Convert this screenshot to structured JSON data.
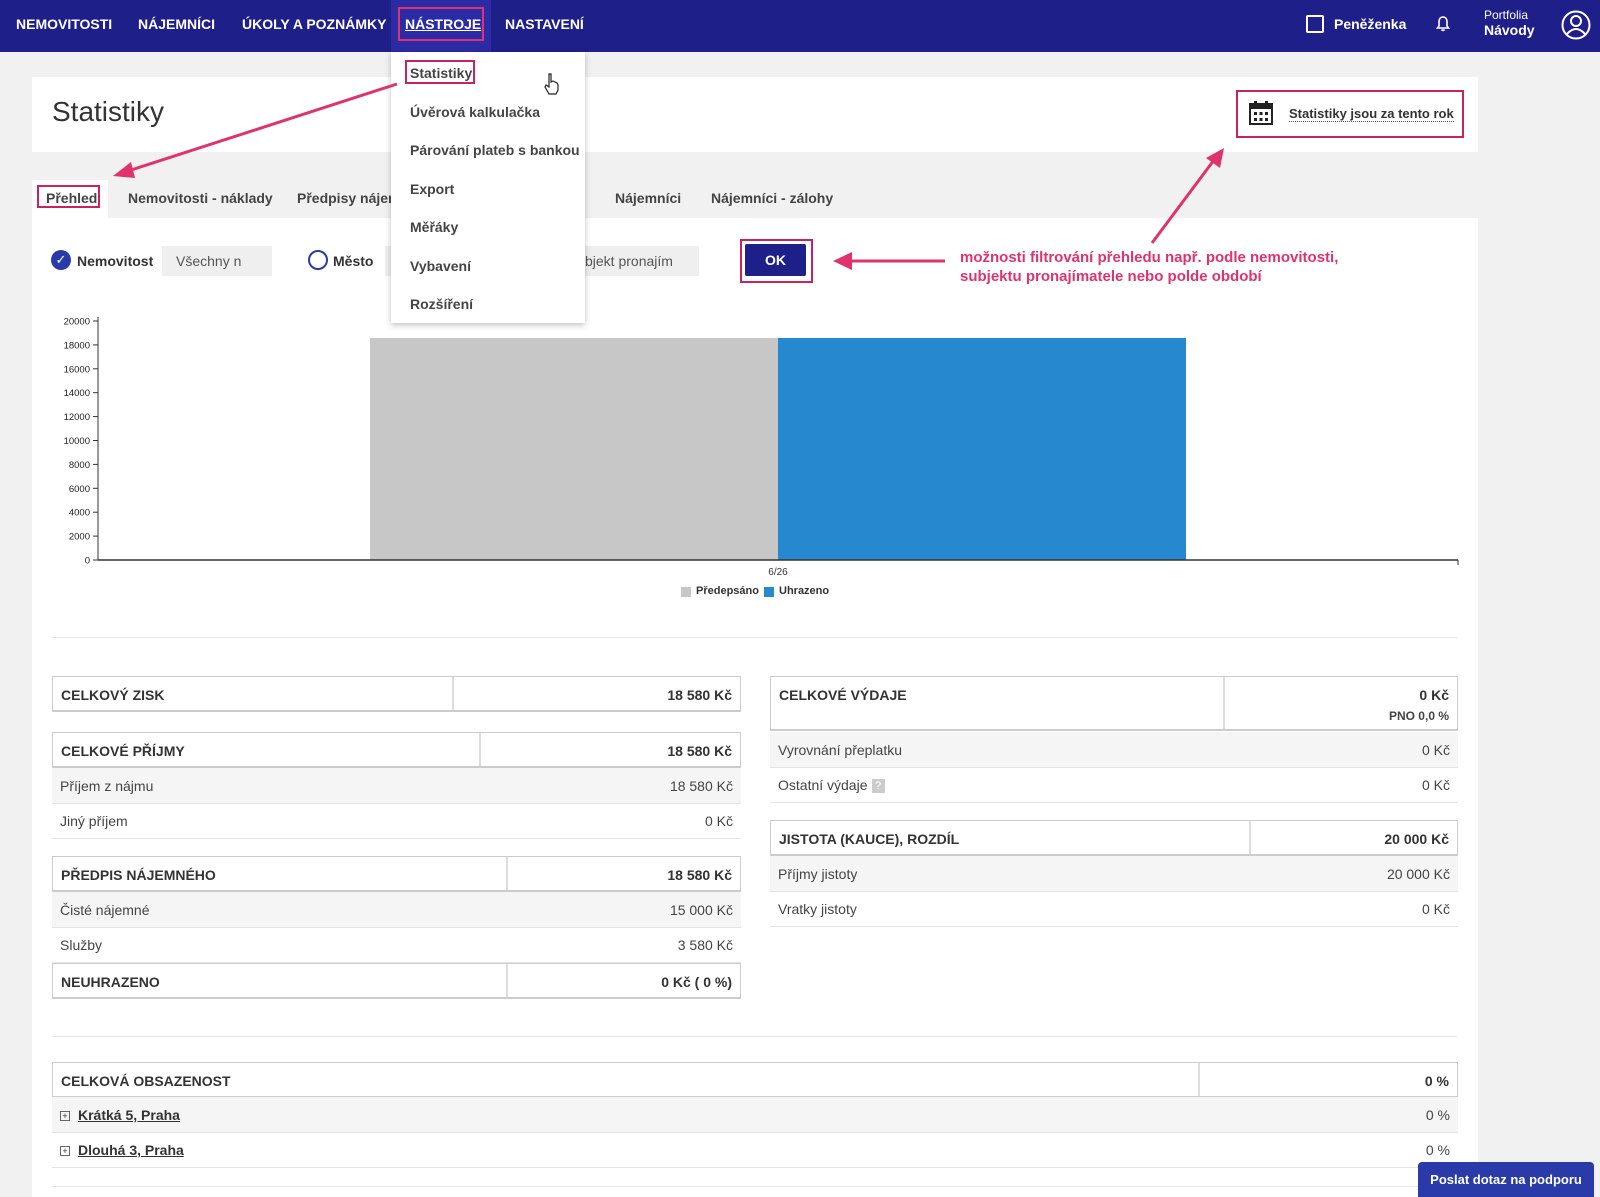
{
  "nav": {
    "items": [
      "NEMOVITOSTI",
      "NÁJEMNÍCI",
      "ÚKOLY A POZNÁMKY",
      "NÁSTROJE",
      "NASTAVENÍ"
    ],
    "wallet": "Peněženka",
    "portfolio_label": "Portfolia",
    "portfolio_name": "Návody"
  },
  "dropdown": {
    "items": [
      "Statistiky",
      "Úvěrová kalkulačka",
      "Párování plateb s bankou",
      "Export",
      "Měřáky",
      "Vybavení",
      "Rozšíření"
    ]
  },
  "header": {
    "title": "Statistiky",
    "period": "Statistiky jsou za tento rok"
  },
  "tabs": [
    "Přehled",
    "Nemovitosti - náklady",
    "Předpisy nájem",
    "Nájemníci",
    "Nájemníci - zálohy"
  ],
  "filters": {
    "property_label": "Nemovitost",
    "property_value": "Všechny n",
    "city_label": "Město",
    "subject_value": "bjekt pronajím",
    "ok": "OK"
  },
  "annotation": {
    "line1": "možnosti filtrování přehledu např. podle nemovitosti,",
    "line2": "subjektu pronajímatele nebo polde období"
  },
  "chart_data": {
    "type": "bar",
    "categories": [
      "6/26"
    ],
    "series": [
      {
        "name": "Předepsáno",
        "values": [
          18580
        ],
        "color": "#c7c7c7"
      },
      {
        "name": "Uhrazeno",
        "values": [
          18580
        ],
        "color": "#2688cf"
      }
    ],
    "yticks": [
      "20000",
      "18000",
      "16000",
      "14000",
      "12000",
      "10000",
      "8000",
      "6000",
      "4000",
      "2000",
      "0"
    ],
    "ylim": [
      0,
      20000
    ],
    "legend": "bottom"
  },
  "stats_left": {
    "total_profit_label": "CELKOVÝ ZISK",
    "total_profit_value": "18 580 Kč",
    "income_label": "CELKOVÉ PŘÍJMY",
    "income_value": "18 580 Kč",
    "rent_income_label": "Příjem z nájmu",
    "rent_income_value": "18 580 Kč",
    "other_income_label": "Jiný příjem",
    "other_income_value": "0 Kč",
    "rent_prescription_label": "PŘEDPIS NÁJEMNÉHO",
    "rent_prescription_value": "18 580 Kč",
    "net_rent_label": "Čisté nájemné",
    "net_rent_value": "15 000 Kč",
    "services_label": "Služby",
    "services_value": "3 580 Kč",
    "unpaid_label": "NEUHRAZENO",
    "unpaid_value": "0 Kč ( 0 %)"
  },
  "stats_right": {
    "expenses_label": "CELKOVÉ VÝDAJE",
    "expenses_value": "0 Kč",
    "pno": "PNO 0,0 %",
    "overpay_label": "Vyrovnání přeplatku",
    "overpay_value": "0 Kč",
    "other_expenses_label": "Ostatní výdaje",
    "other_expenses_value": "0 Kč",
    "qmark": "?",
    "deposit_label": "JISTOTA (KAUCE), ROZDÍL",
    "deposit_value": "20 000 Kč",
    "deposit_income_label": "Příjmy jistoty",
    "deposit_income_value": "20 000 Kč",
    "deposit_return_label": "Vratky jistoty",
    "deposit_return_value": "0 Kč"
  },
  "occupancy": {
    "label": "CELKOVÁ OBSAZENOST",
    "value": "0 %",
    "properties": [
      {
        "name": "Krátká 5, Praha",
        "value": "0 %"
      },
      {
        "name": "Dlouhá 3, Praha",
        "value": "0 %"
      }
    ]
  },
  "support": "Poslat dotaz na podporu",
  "colors": {
    "nav_bg": "#1f1f8a",
    "accent_pink": "#e0336e",
    "bar_gray": "#c7c7c7",
    "bar_blue": "#2688cf"
  }
}
